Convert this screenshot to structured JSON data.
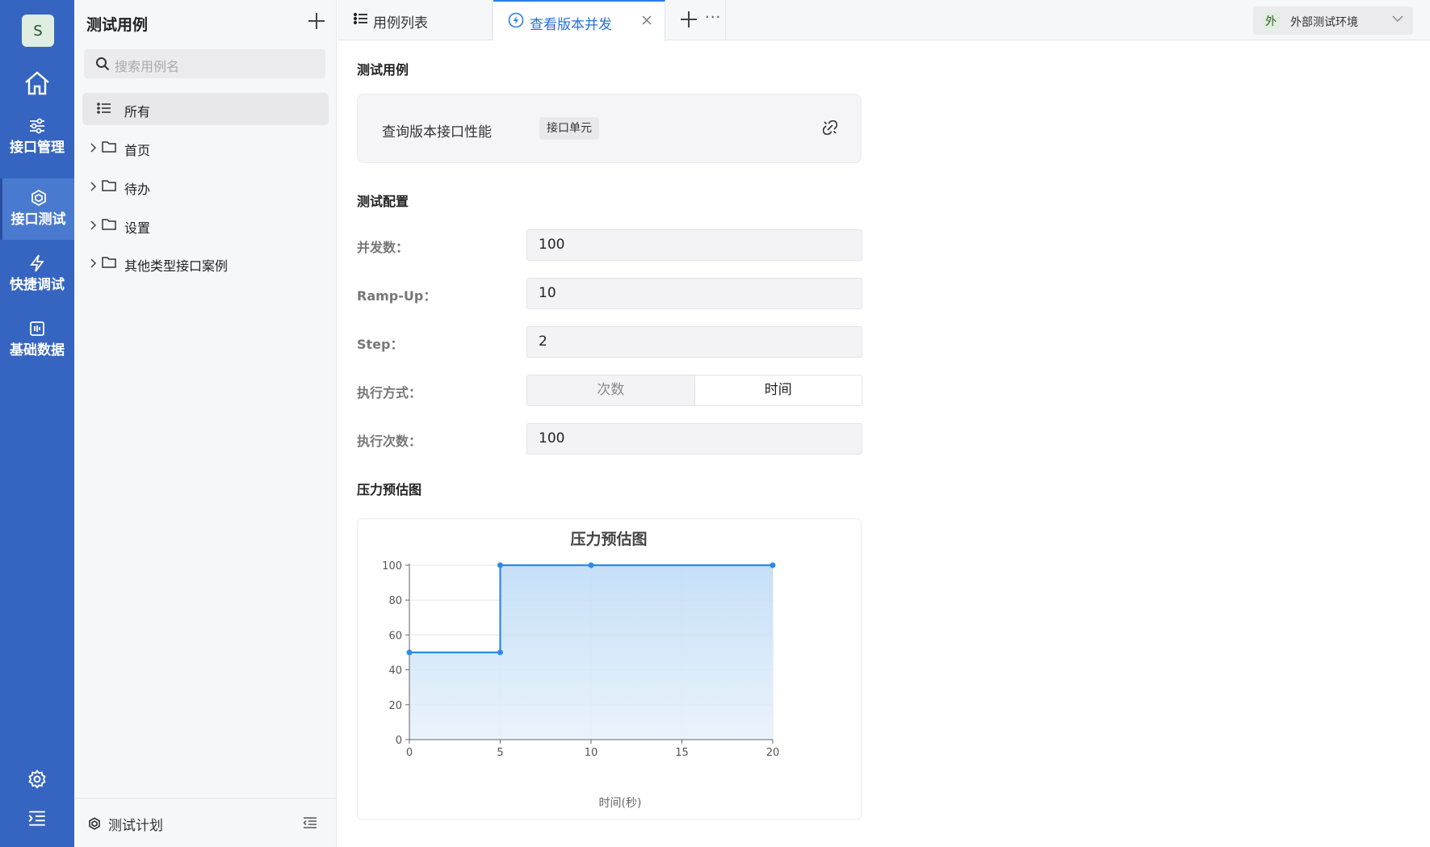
{
  "rail": {
    "avatar": "S",
    "items": [
      {
        "label": "接口管理"
      },
      {
        "label": "接口测试"
      },
      {
        "label": "快捷调试"
      },
      {
        "label": "基础数据"
      }
    ]
  },
  "tree": {
    "title": "测试用例",
    "search_placeholder": "搜索用例名",
    "items": [
      {
        "label": "所有"
      },
      {
        "label": "首页"
      },
      {
        "label": "待办"
      },
      {
        "label": "设置"
      },
      {
        "label": "其他类型接口案例"
      }
    ],
    "footer_label": "测试计划"
  },
  "tabs": {
    "list_label": "用例列表",
    "active_label": "查看版本并发",
    "more": "···"
  },
  "env": {
    "badge": "外",
    "label": "外部测试环境"
  },
  "main": {
    "section_case": "测试用例",
    "case_name": "查询版本接口性能",
    "case_tag": "接口单元",
    "section_config": "测试配置",
    "concurrency_label": "并发数：",
    "concurrency_value": "100",
    "rampup_label": "Ramp-Up：",
    "rampup_value": "10",
    "step_label": "Step：",
    "step_value": "2",
    "mode_label": "执行方式：",
    "mode_options": [
      "次数",
      "时间"
    ],
    "mode_selected": "时间",
    "count_label": "执行次数：",
    "count_value": "100",
    "section_chart": "压力预估图"
  },
  "colors": {
    "accent": "#2b7de9",
    "rail": "#3565c0"
  },
  "chart_data": {
    "type": "line",
    "title": "压力预估图",
    "xlabel": "时间(秒)",
    "ylabel": "",
    "x": [
      0,
      5,
      5,
      10,
      20
    ],
    "y": [
      50,
      50,
      100,
      100,
      100
    ],
    "xlim": [
      0,
      20
    ],
    "ylim": [
      0,
      100
    ],
    "xticks": [
      0,
      5,
      10,
      15,
      20
    ],
    "yticks": [
      0,
      20,
      40,
      60,
      80,
      100
    ],
    "area_fill": true,
    "grid": true
  }
}
